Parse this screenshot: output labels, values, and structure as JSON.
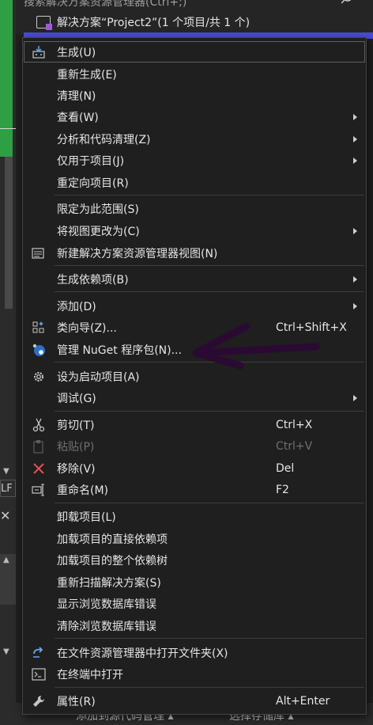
{
  "background": {
    "search_placeholder": "搜索解决方案资源管理器(Ctrl+;)",
    "solution_label": "解决方案“Project2”(1 个项目/共 1 个)",
    "left_line_ending": "LF",
    "bottom_left": "添加到源代码管理 ▴",
    "bottom_right": "选择存储库 ▴"
  },
  "menu": {
    "items": [
      {
        "label": "生成(U)",
        "icon": "build-icon"
      },
      {
        "label": "重新生成(E)"
      },
      {
        "label": "清理(N)"
      },
      {
        "label": "查看(W)",
        "submenu": true
      },
      {
        "label": "分析和代码清理(Z)",
        "submenu": true
      },
      {
        "label": "仅用于项目(J)",
        "submenu": true
      },
      {
        "label": "重定向项目(R)"
      },
      {
        "label": "限定为此范围(S)"
      },
      {
        "label": "将视图更改为(C)",
        "submenu": true
      },
      {
        "label": "新建解决方案资源管理器视图(N)",
        "icon": "new-view-icon"
      },
      {
        "label": "生成依赖项(B)",
        "submenu": true
      },
      {
        "label": "添加(D)",
        "submenu": true
      },
      {
        "label": "类向导(Z)...",
        "shortcut": "Ctrl+Shift+X",
        "icon": "class-wizard-icon"
      },
      {
        "label": "管理 NuGet 程序包(N)...",
        "icon": "nuget-icon"
      },
      {
        "label": "设为启动项目(A)",
        "icon": "gear-icon"
      },
      {
        "label": "调试(G)",
        "submenu": true
      },
      {
        "label": "剪切(T)",
        "shortcut": "Ctrl+X",
        "icon": "scissors-icon"
      },
      {
        "label": "粘贴(P)",
        "shortcut": "Ctrl+V",
        "icon": "paste-icon",
        "disabled": true
      },
      {
        "label": "移除(V)",
        "shortcut": "Del",
        "icon": "remove-icon"
      },
      {
        "label": "重命名(M)",
        "shortcut": "F2",
        "icon": "rename-icon"
      },
      {
        "label": "卸载项目(L)"
      },
      {
        "label": "加载项目的直接依赖项"
      },
      {
        "label": "加载项目的整个依赖树"
      },
      {
        "label": "重新扫描解决方案(S)"
      },
      {
        "label": "显示浏览数据库错误"
      },
      {
        "label": "清除浏览数据库错误"
      },
      {
        "label": "在文件资源管理器中打开文件夹(X)",
        "icon": "open-folder-icon"
      },
      {
        "label": "在终端中打开",
        "icon": "terminal-icon"
      },
      {
        "label": "属性(R)",
        "shortcut": "Alt+Enter",
        "icon": "wrench-icon"
      }
    ]
  },
  "colors": {
    "menu_bg": "#1f1f1f",
    "menu_border": "#454545",
    "accent_blue": "#4a4bd6",
    "annotation_purple": "#2a0a33",
    "remove_red": "#e05252"
  }
}
